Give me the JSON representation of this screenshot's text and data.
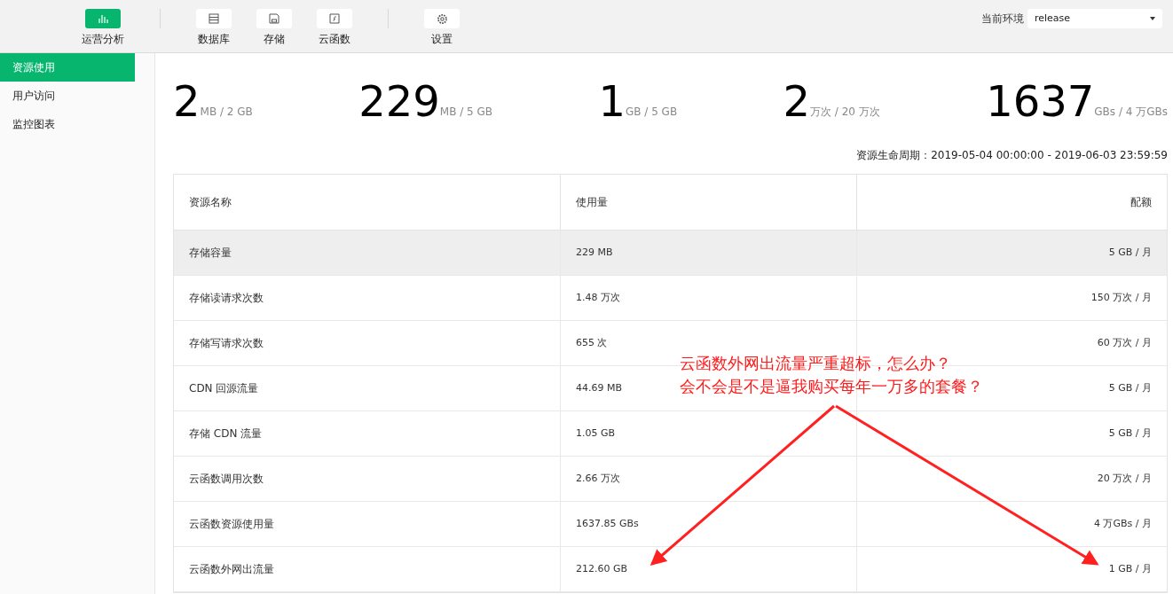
{
  "nav_groups": [
    [
      {
        "label": "运营分析",
        "selected": true
      }
    ],
    [
      {
        "label": "数据库",
        "selected": false
      },
      {
        "label": "存储",
        "selected": false
      },
      {
        "label": "云函数",
        "selected": false
      }
    ],
    [
      {
        "label": "设置",
        "selected": false
      }
    ]
  ],
  "environment": {
    "label": "当前环境",
    "value": "release"
  },
  "sidebar": {
    "items": [
      {
        "label": "资源使用",
        "selected": true
      },
      {
        "label": "用户访问",
        "selected": false
      },
      {
        "label": "监控图表",
        "selected": false
      }
    ]
  },
  "stats": [
    {
      "value": "2",
      "unit": "MB / 2 GB"
    },
    {
      "value": "229",
      "unit": "MB / 5 GB"
    },
    {
      "value": "1",
      "unit": "GB / 5 GB"
    },
    {
      "value": "2",
      "unit": "万次 / 20 万次"
    },
    {
      "value": "1637",
      "unit": "GBs / 4 万GBs"
    }
  ],
  "lifecycle": "资源生命周期：2019-05-04 00:00:00 - 2019-06-03 23:59:59",
  "table": {
    "columns": [
      "资源名称",
      "使用量",
      "配额"
    ],
    "rows": [
      {
        "cells": [
          "存储容量",
          "229 MB",
          "5 GB / 月"
        ],
        "highlighted": true
      },
      {
        "cells": [
          "存储读请求次数",
          "1.48 万次",
          "150 万次 / 月"
        ],
        "highlighted": false
      },
      {
        "cells": [
          "存储写请求次数",
          "655 次",
          "60 万次 / 月"
        ],
        "highlighted": false
      },
      {
        "cells": [
          "CDN 回源流量",
          "44.69 MB",
          "5 GB / 月"
        ],
        "highlighted": false
      },
      {
        "cells": [
          "存储 CDN 流量",
          "1.05 GB",
          "5 GB / 月"
        ],
        "highlighted": false
      },
      {
        "cells": [
          "云函数调用次数",
          "2.66 万次",
          "20 万次 / 月"
        ],
        "highlighted": false
      },
      {
        "cells": [
          "云函数资源使用量",
          "1637.85 GBs",
          "4 万GBs / 月"
        ],
        "highlighted": false
      },
      {
        "cells": [
          "云函数外网出流量",
          "212.60 GB",
          "1 GB / 月"
        ],
        "highlighted": false
      }
    ]
  },
  "annotation": {
    "lines": [
      "云函数外网出流量严重超标，怎么办？",
      "会不会是不是逼我购买每年一万多的套餐？"
    ]
  }
}
